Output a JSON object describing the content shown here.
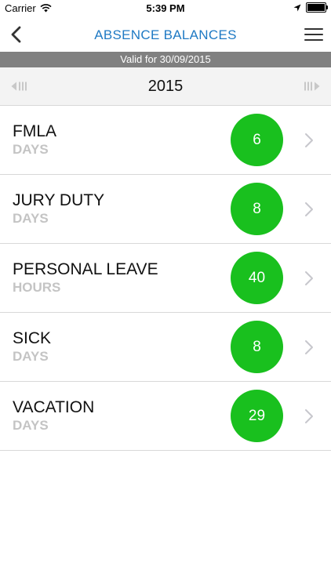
{
  "status_bar": {
    "carrier": "Carrier",
    "time": "5:39 PM"
  },
  "nav": {
    "title": "ABSENCE BALANCES"
  },
  "valid_banner": {
    "text": "Valid for 30/09/2015"
  },
  "year_selector": {
    "year": "2015"
  },
  "balances": [
    {
      "name": "FMLA",
      "unit": "DAYS",
      "value": "6"
    },
    {
      "name": "JURY DUTY",
      "unit": "DAYS",
      "value": "8"
    },
    {
      "name": "PERSONAL LEAVE",
      "unit": "HOURS",
      "value": "40"
    },
    {
      "name": "SICK",
      "unit": "DAYS",
      "value": "8"
    },
    {
      "name": "VACATION",
      "unit": "DAYS",
      "value": "29"
    }
  ],
  "colors": {
    "title_blue": "#1f7ac4",
    "badge_green": "#19c01e",
    "banner_gray": "#808080"
  }
}
